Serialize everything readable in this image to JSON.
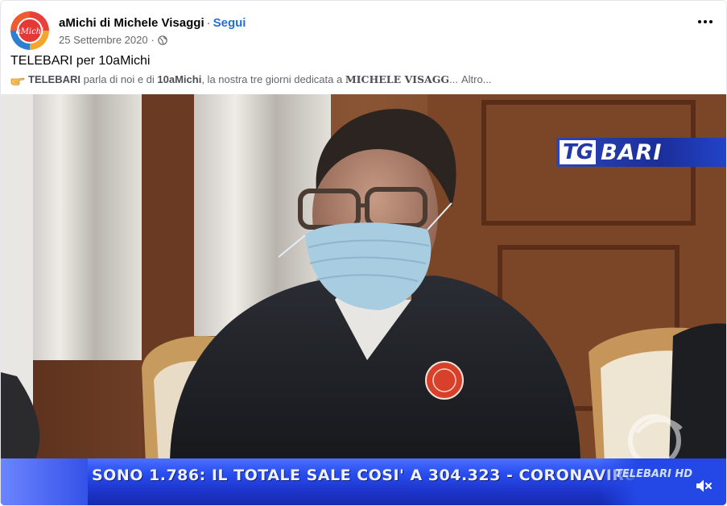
{
  "header": {
    "page_name": "aMichi di Michele Visaggi",
    "separator": "·",
    "follow_label": "Segui",
    "date": "25 Settembre 2020",
    "date_separator": "·",
    "avatar_text": "aMichi",
    "privacy_icon": "globe-icon",
    "more_icon": "more-options-icon"
  },
  "post": {
    "title": "TELEBARI per 10aMichi",
    "text_part1": "TELEBARI",
    "text_part2": " parla di noi e di ",
    "text_part3": "10aMichi",
    "text_part4": ", la nostra tre giorni dedicata a ",
    "text_part5": "MICHELE VISAGG",
    "text_ellipsis": "...",
    "more_link": "Altro...",
    "emoji_icon": "pointing-hand-icon"
  },
  "video": {
    "channel_logo_tg": "TG",
    "channel_logo_city": "BARI",
    "ticker_text": "SONO 1.786: IL TOTALE SALE COSI' A 304.323 - CORONAVIRU",
    "ticker_brand": "TELEBARI HD",
    "volume_icon": "volume-muted-icon"
  },
  "colors": {
    "link_blue": "#216fdb",
    "secondary_text": "#65676b",
    "ticker_blue": "#1c33c8"
  }
}
